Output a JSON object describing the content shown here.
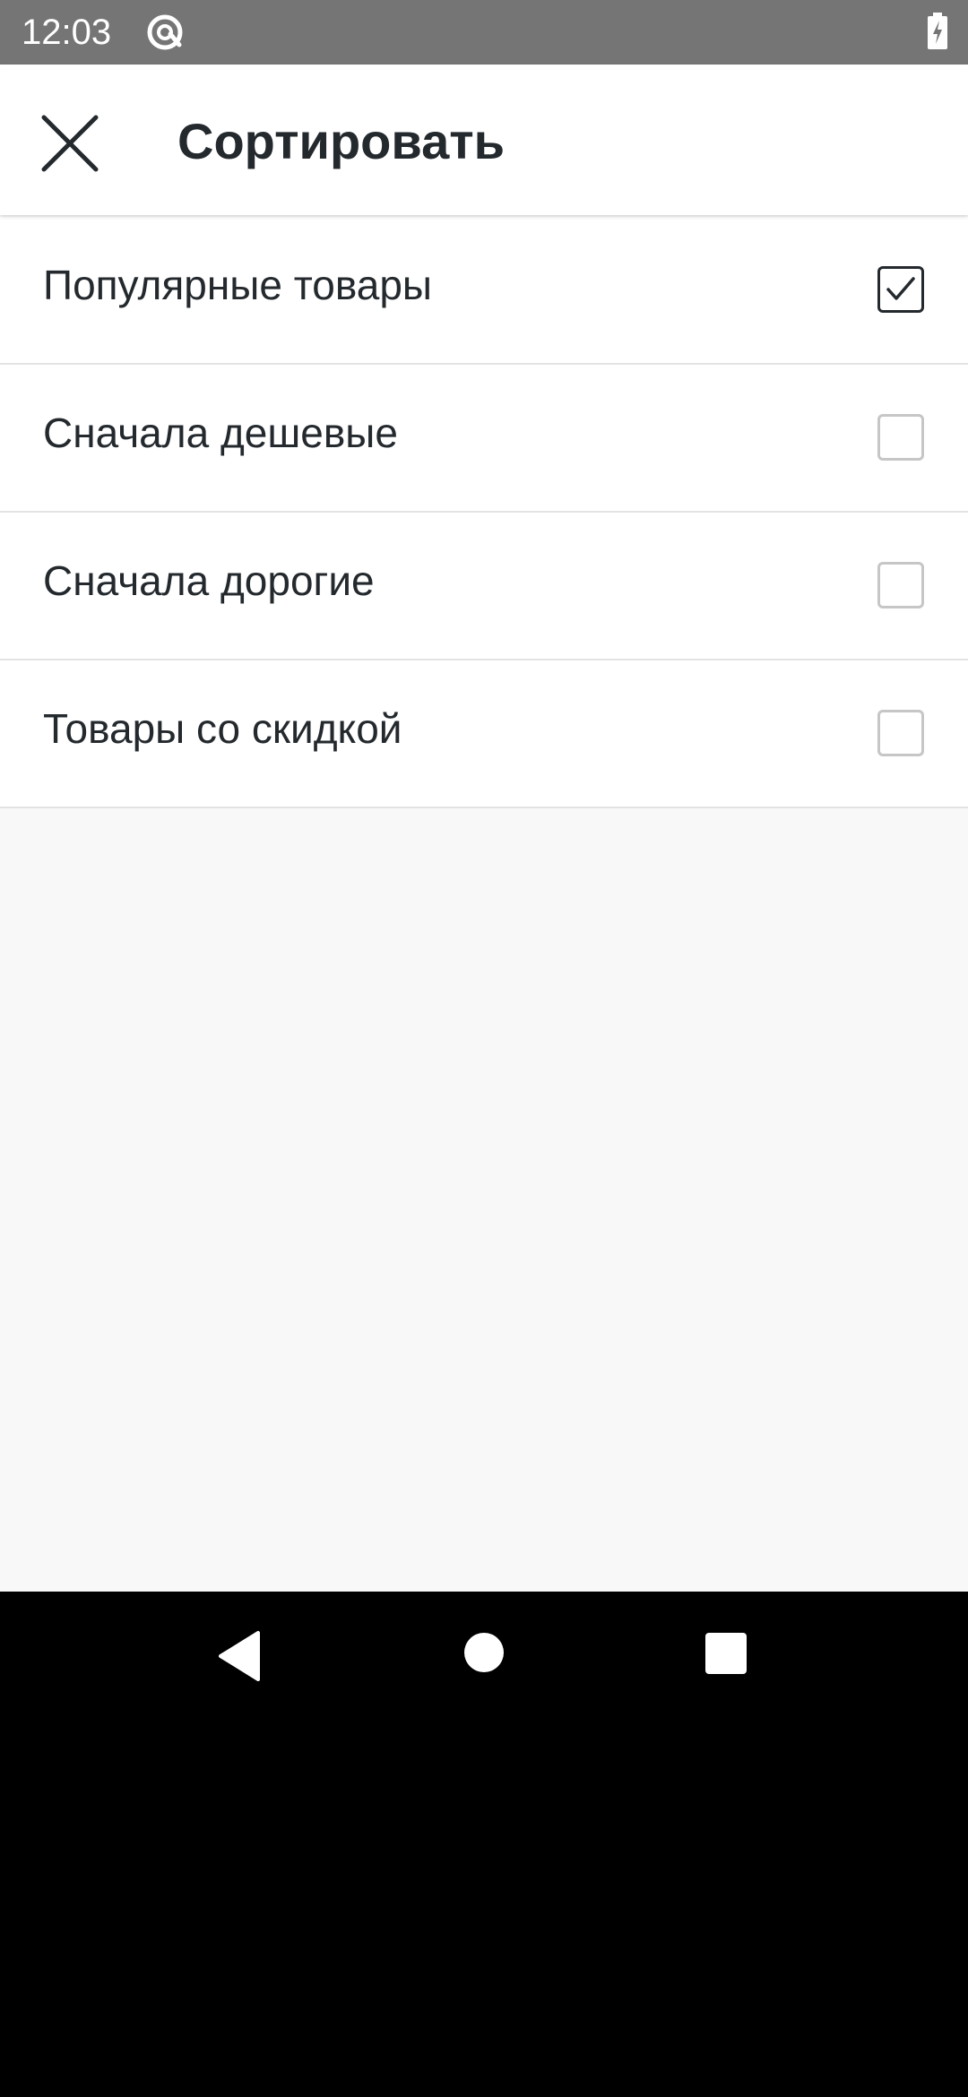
{
  "status_bar": {
    "time": "12:03",
    "app_icon": "at-sign-circle-icon",
    "battery_icon": "battery-charging-icon"
  },
  "toolbar": {
    "close_icon": "close-icon",
    "title": "Сортировать"
  },
  "sort_options": [
    {
      "label": "Популярные товары",
      "checked": true
    },
    {
      "label": "Сначала дешевые",
      "checked": false
    },
    {
      "label": "Сначала дорогие",
      "checked": false
    },
    {
      "label": "Товары со скидкой",
      "checked": false
    }
  ],
  "nav_bar": {
    "back_icon": "back-triangle-icon",
    "home_icon": "home-circle-icon",
    "recents_icon": "recents-square-icon"
  },
  "colors": {
    "status_bar": "#757575",
    "toolbar_bg": "#ffffff",
    "text": "#24292e",
    "divider": "#e3e3e3",
    "checkbox_border": "#c6c6c6",
    "background": "#f8f8f8",
    "nav_bar": "#000000"
  }
}
